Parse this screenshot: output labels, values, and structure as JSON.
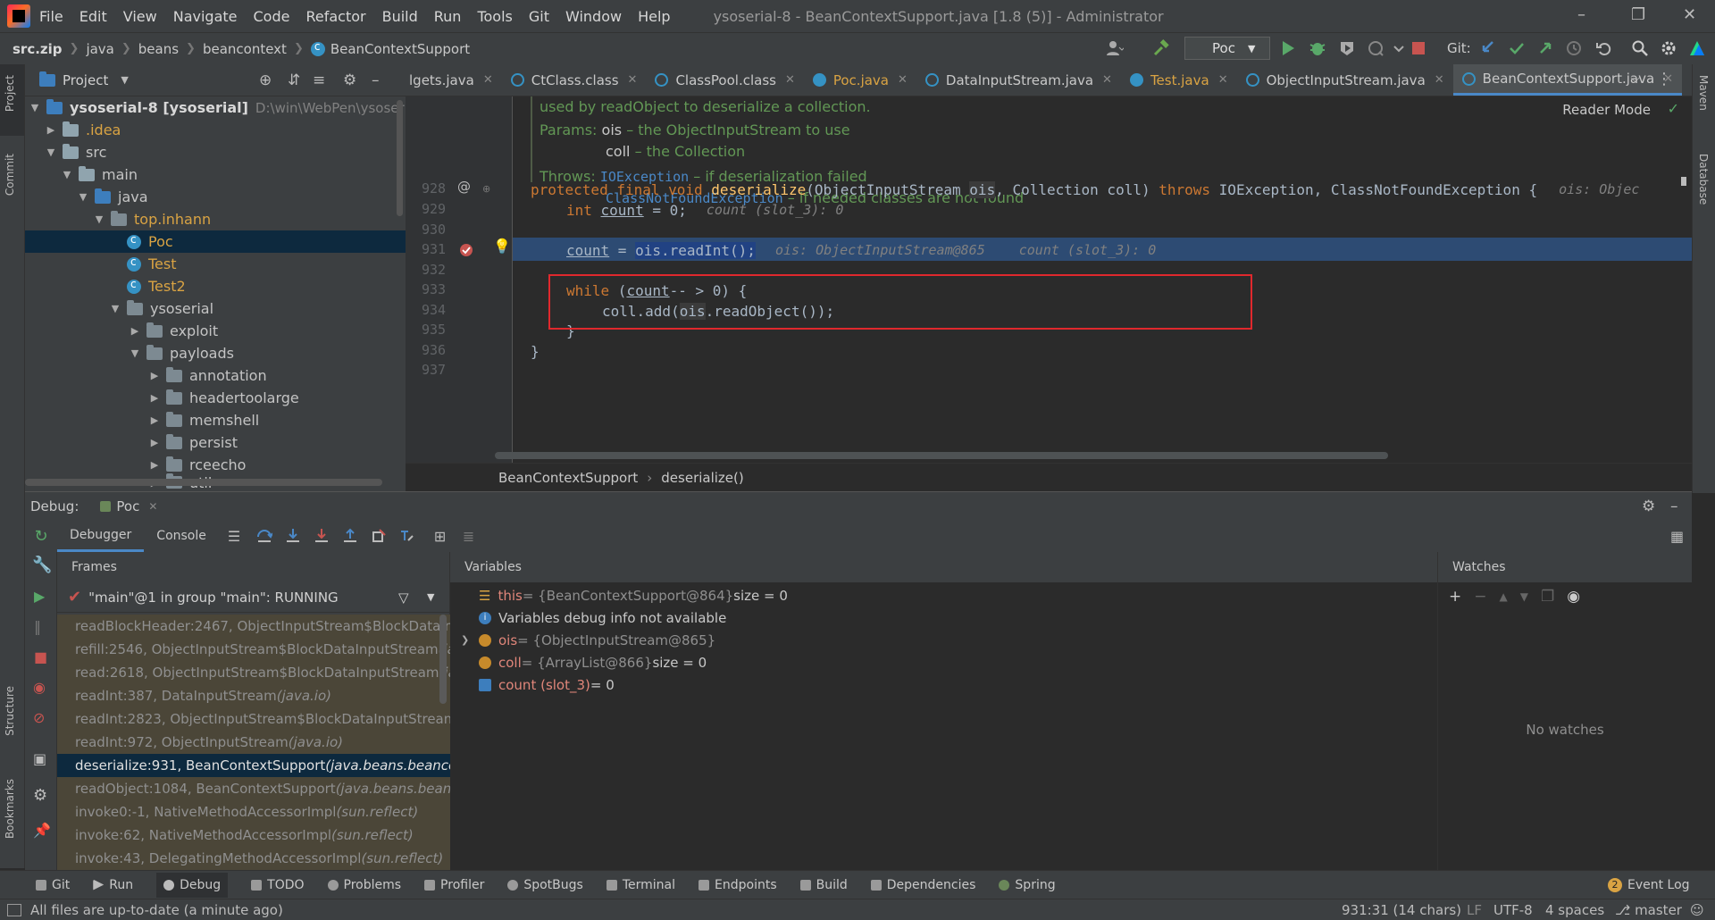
{
  "menu": [
    "File",
    "Edit",
    "View",
    "Navigate",
    "Code",
    "Refactor",
    "Build",
    "Run",
    "Tools",
    "Git",
    "Window",
    "Help"
  ],
  "window_title": "ysoserial-8 - BeanContextSupport.java [1.8 (5)] - Administrator",
  "nav_crumbs": [
    "src.zip",
    "java",
    "beans",
    "beancontext",
    "BeanContextSupport"
  ],
  "run_config": "Poc",
  "git_label": "Git:",
  "left_strip": {
    "project": "Project",
    "commit": "Commit",
    "structure": "Structure",
    "bookmarks": "Bookmarks"
  },
  "right_strip": {
    "maven": "Maven",
    "database": "Database"
  },
  "project_panel": {
    "title": "Project",
    "tree": [
      {
        "label": "ysoserial-8 [ysoserial]",
        "extra": "D:\\win\\WebPen\\ysoserial-8"
      },
      {
        "label": ".idea"
      },
      {
        "label": "src"
      },
      {
        "label": "main"
      },
      {
        "label": "java"
      },
      {
        "label": "top.inhann"
      },
      {
        "label": "Poc"
      },
      {
        "label": "Test"
      },
      {
        "label": "Test2"
      },
      {
        "label": "ysoserial"
      },
      {
        "label": "exploit"
      },
      {
        "label": "payloads"
      },
      {
        "label": "annotation"
      },
      {
        "label": "headertoolarge"
      },
      {
        "label": "memshell"
      },
      {
        "label": "persist"
      },
      {
        "label": "rceecho"
      },
      {
        "label": "util"
      }
    ]
  },
  "editor_tabs": [
    {
      "label": "lgets.java"
    },
    {
      "label": "CtClass.class"
    },
    {
      "label": "ClassPool.class"
    },
    {
      "label": "Poc.java"
    },
    {
      "label": "DataInputStream.java"
    },
    {
      "label": "Test.java"
    },
    {
      "label": "ObjectInputStream.java"
    },
    {
      "label": "BeanContextSupport.java"
    }
  ],
  "editor": {
    "reader_mode": "Reader Mode",
    "doc": {
      "line1": "used by readObject to deserialize a collection.",
      "params_label": "Params:",
      "p1_name": "ois",
      "p1_desc": " – the ObjectInputStream to use",
      "p2_name": "coll",
      "p2_desc": " – the Collection",
      "throws_label": "Throws:",
      "t1_name": "IOException",
      "t1_desc": " – if deserialization failed",
      "t2_name": "ClassNotFoundException",
      "t2_desc": " – if needed classes are not found"
    },
    "line_numbers": [
      "928",
      "929",
      "930",
      "931",
      "932",
      "933",
      "934",
      "935",
      "936",
      "937"
    ],
    "code": {
      "l928_mods": "protected final void ",
      "l928_fn": "deserialize",
      "l928_p1t": "ObjectInputStream ",
      "l928_p1": "ois",
      "l928_p2": ", Collection coll) ",
      "l928_throws": "throws ",
      "l928_ex": "IOException, ClassNotFoundException {",
      "l928_hint": "ois: Objec",
      "l929_kw": "int ",
      "l929_var": "count",
      "l929_rest": " = 0;",
      "l929_hint": "count (slot_3): 0",
      "l931_var": "count",
      "l931_rest": " = ",
      "l931_call": "ois.readInt();",
      "l931_hint1": "ois: ObjectInputStream@865",
      "l931_hint2": "count (slot_3): 0",
      "l933_kw": "while ",
      "l933_rest1": "(",
      "l933_var": "count",
      "l933_rest2": "-- > 0) {",
      "l934_a": "coll.add(",
      "l934_b": "ois",
      "l934_c": ".readObject());",
      "l935": "}",
      "l936": "}"
    },
    "breadcrumb": [
      "BeanContextSupport",
      "deserialize()"
    ]
  },
  "debug": {
    "label": "Debug:",
    "session": "Poc",
    "tabs": [
      "Debugger",
      "Console"
    ],
    "frames_title": "Frames",
    "thread": "\"main\"@1 in group \"main\": RUNNING",
    "frames": [
      {
        "method": "readBlockHeader:2467, ObjectInputStream$BlockDataInp",
        "pkg": ""
      },
      {
        "method": "refill:2546, ObjectInputStream$BlockDataInputStream ",
        "pkg": "(jav"
      },
      {
        "method": "read:2618, ObjectInputStream$BlockDataInputStream ",
        "pkg": "(jav"
      },
      {
        "method": "readInt:387, DataInputStream ",
        "pkg": "(java.io)"
      },
      {
        "method": "readInt:2823, ObjectInputStream$BlockDataInputStream ",
        "pkg": "(j"
      },
      {
        "method": "readInt:972, ObjectInputStream ",
        "pkg": "(java.io)"
      },
      {
        "method": "deserialize:931, BeanContextSupport ",
        "pkg": "(java.beans.beancon"
      },
      {
        "method": "readObject:1084, BeanContextSupport ",
        "pkg": "(java.beans.beanco"
      },
      {
        "method": "invoke0:-1, NativeMethodAccessorImpl ",
        "pkg": "(sun.reflect)"
      },
      {
        "method": "invoke:62, NativeMethodAccessorImpl ",
        "pkg": "(sun.reflect)"
      },
      {
        "method": "invoke:43, DelegatingMethodAccessorImpl ",
        "pkg": "(sun.reflect)"
      }
    ],
    "variables_title": "Variables",
    "variables": [
      {
        "name": "this",
        "value": " = {BeanContextSupport@864} ",
        "extra": "size = 0"
      },
      {
        "name": "Variables debug info not available",
        "value": "",
        "extra": ""
      },
      {
        "name": "ois",
        "value": " = {ObjectInputStream@865}",
        "extra": ""
      },
      {
        "name": "coll",
        "value": " = {ArrayList@866} ",
        "extra": "size = 0"
      },
      {
        "name": "count (slot_3)",
        "value": " = 0",
        "extra": ""
      }
    ],
    "watches_title": "Watches",
    "no_watches": "No watches"
  },
  "bottom_tools": [
    "Git",
    "Run",
    "Debug",
    "TODO",
    "Problems",
    "Profiler",
    "SpotBugs",
    "Terminal",
    "Endpoints",
    "Build",
    "Dependencies",
    "Spring"
  ],
  "event_log": {
    "count": "2",
    "label": "Event Log"
  },
  "status": {
    "message": "All files are up-to-date (a minute ago)",
    "position": "931:31 (14 chars)",
    "line_sep": "LF",
    "encoding": "UTF-8",
    "indent": "4 spaces",
    "branch": "master"
  },
  "colors": {
    "breakpoint": "#c75450",
    "accent": "#4a88c7",
    "highlight_box": "#e0282d",
    "selection": "#2d4b73"
  }
}
